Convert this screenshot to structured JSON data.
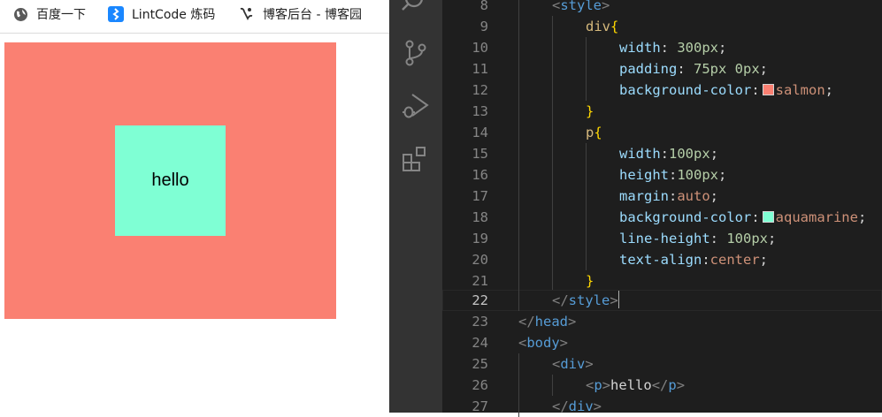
{
  "browser": {
    "bookmarks": [
      {
        "label": "百度一下",
        "icon": "globe-icon"
      },
      {
        "label": "LintCode 炼码",
        "icon": "lintcode-icon"
      },
      {
        "label": "博客后台 - 博客园",
        "icon": "cnblogs-icon"
      }
    ],
    "preview": {
      "text": "hello",
      "outer_color": "#fa8072",
      "inner_color": "#7fffd4"
    }
  },
  "activity_bar": {
    "icons": [
      "search-icon",
      "source-control-icon",
      "run-debug-icon",
      "extensions-icon"
    ]
  },
  "editor": {
    "current_line": 22,
    "lines": [
      {
        "n": "8"
      },
      {
        "n": "9"
      },
      {
        "n": "10"
      },
      {
        "n": "11"
      },
      {
        "n": "12"
      },
      {
        "n": "13"
      },
      {
        "n": "14"
      },
      {
        "n": "15"
      },
      {
        "n": "16"
      },
      {
        "n": "17"
      },
      {
        "n": "18"
      },
      {
        "n": "19"
      },
      {
        "n": "20"
      },
      {
        "n": "21"
      },
      {
        "n": "22"
      },
      {
        "n": "23"
      },
      {
        "n": "24"
      },
      {
        "n": "25"
      },
      {
        "n": "26"
      },
      {
        "n": "27"
      }
    ],
    "tokens": {
      "style": "style",
      "div": "div",
      "width": "width",
      "300px": "300px",
      "padding": "padding",
      "75px": "75px",
      "0px": "0px",
      "bgc": "background-color",
      "salmon": "salmon",
      "p": "p",
      "100px": "100px",
      "height": "height",
      "margin": "margin",
      "auto": "auto",
      "aquamarine": "aquamarine",
      "line_height": "line-height",
      "text_align": "text-align",
      "center": "center",
      "head": "head",
      "body": "body",
      "hello": "hello"
    },
    "swatches": {
      "salmon": "#fa8072",
      "aquamarine": "#7fffd4"
    }
  }
}
